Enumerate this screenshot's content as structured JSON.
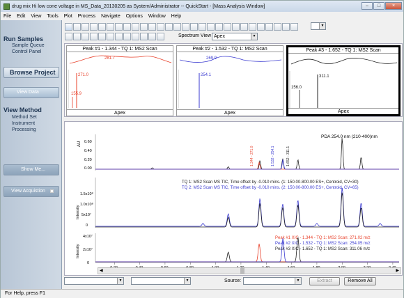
{
  "window": {
    "title": "drug mix Hi low cone voltage in MS_Data_20130205 as System/Administrator -- QuickStart - [Mass Analysis Window]"
  },
  "window_buttons": {
    "minimize": "–",
    "maximize": "□",
    "close": "×"
  },
  "menu": [
    "File",
    "Edit",
    "View",
    "Tools",
    "Plot",
    "Process",
    "Navigate",
    "Options",
    "Window",
    "Help"
  ],
  "sidebar": {
    "run_samples": "Run Samples",
    "run_items": [
      "Sample Queue",
      "Control Panel"
    ],
    "browse_project": "Browse Project",
    "view_data": "View Data",
    "view_method": "View Method",
    "method_items": [
      "Method Set",
      "Instrument",
      "Processing"
    ],
    "show_me": "Show Me...",
    "view_acquisition": "View Acquistion"
  },
  "spectrum_view": {
    "label": "Spectrum View",
    "value": "Apex"
  },
  "peaks": [
    {
      "title": "Peak #1 - 1.344 - TQ 1: MS2 Scan",
      "top_label": "281.7",
      "label_main": "271.0",
      "label_minor": "155.9",
      "color": "#e8402a",
      "footer": "Apex"
    },
    {
      "title": "Peak #2 - 1.532 - TQ 1: MS2 Scan",
      "top_label": "269.9",
      "label_main": "254.1",
      "label_minor": "",
      "color": "#3a3ad0",
      "footer": "Apex"
    },
    {
      "title": "Peak #3 - 1.652 - TQ 1: MS2 Scan",
      "top_label": "",
      "label_main": "311.1",
      "label_minor": "156.0",
      "color": "#222222",
      "footer": "Apex"
    }
  ],
  "chart_data": [
    {
      "type": "line",
      "title": "PDA 254.0 nm (210-400)nm",
      "ylabel": "AU",
      "yticks": [
        "0.00",
        "0.20",
        "0.40",
        "0.60"
      ],
      "peak_labels": [
        "1.344 - 271.0",
        "1.532 - 254.1",
        "1.652 - 311.1"
      ],
      "peaks_x": [
        0.5,
        1.1,
        1.35,
        1.53,
        1.65,
        2.0,
        2.15
      ],
      "peaks_y": [
        0.03,
        0.05,
        0.18,
        0.22,
        0.2,
        0.66,
        0.26
      ]
    },
    {
      "type": "line",
      "ylabel": "Intensity",
      "yticks": [
        "0",
        "5x10⁷",
        "1.0x10⁸",
        "1.5x10⁸"
      ],
      "series": [
        {
          "name": "TQ 1: MS2 Scan MS TIC, Time offset by -0.010 mins. (1: 150.00-800.00 ES+, Centroid, CV=30)",
          "color": "#222222"
        },
        {
          "name": "TQ 2: MS2 Scan MS TIC, Time offset by -0.010 mins. (2: 150.00-800.00 ES+, Centroid, CV=65)",
          "color": "#3a3ad0"
        }
      ]
    },
    {
      "type": "line",
      "ylabel": "Intensity",
      "yticks": [
        "0",
        "2x10⁷",
        "4x10⁷"
      ],
      "series": [
        {
          "name": "Peak #1 XIC - 1.344 - TQ 1: MS2 Scan: 271.02 m/z",
          "color": "#e8402a"
        },
        {
          "name": "Peak #2 XIC - 1.532 - TQ 1: MS2 Scan: 254.05 m/z",
          "color": "#3a3ad0"
        },
        {
          "name": "Peak #3 XIC - 1.652 - TQ 1: MS2 Scan: 311.06 m/z",
          "color": "#222222"
        }
      ],
      "xticks": [
        "0.20",
        "0.40",
        "0.60",
        "0.80",
        "1.00",
        "1.20",
        "1.40",
        "1.60",
        "1.80",
        "2.00",
        "2.20",
        "2.40"
      ],
      "xlabel": "Minutes"
    }
  ],
  "bottom": {
    "source_label": "Source:",
    "extract_label": "Extract",
    "remove_all_label": "Remove All"
  },
  "status": "For Help, press F1"
}
